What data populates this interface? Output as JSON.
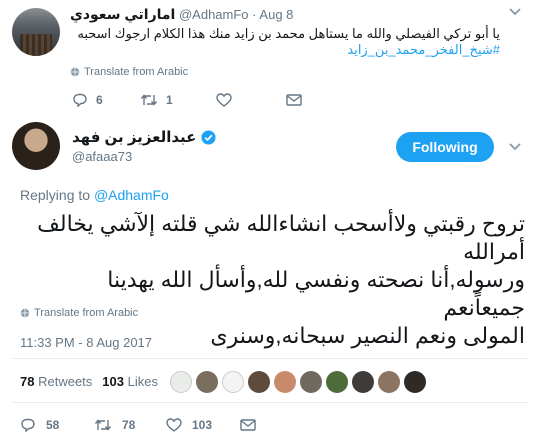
{
  "tweet1": {
    "display_name": "اماراتي سعودي",
    "handle": "@AdhamFo",
    "separator": "·",
    "date": "Aug 8",
    "text": "يا أبو تركي الفيصلي والله ما يستاهل محمد بن زايد منك هذا الكلام ارجوك اسحبه",
    "hashtag": "#شيخ_الفخر_محمد_بن_زايد",
    "translate": "Translate from Arabic",
    "actions": {
      "replies": "6",
      "retweets": "1"
    }
  },
  "tweet2": {
    "display_name": "عبدالعزيز بن فهد",
    "handle": "@afaaa73",
    "follow_label": "Following",
    "replying_prefix": "Replying to",
    "replying_to": "@AdhamFo",
    "text_line1": "تروح رقبتي ولاأسحب انشاءالله شي قلته إلآشي يخالف أمرالله",
    "text_line2": "ورسوله,أنا نصحته ونفسي لله,وأسأل الله يهدينا جميعاًنعم",
    "text_line3": "المولى ونعم النصير سبحانه,وسنرى",
    "translate": "Translate from Arabic",
    "timestamp": "11:33 PM - 8 Aug 2017",
    "stats": {
      "retweets_count": "78",
      "retweets_label": "Retweets",
      "likes_count": "103",
      "likes_label": "Likes"
    },
    "actions": {
      "replies": "58",
      "retweets": "78",
      "likes": "103"
    }
  },
  "colors": {
    "accent": "#1da1f2",
    "text": "#14171a",
    "muted": "#657786",
    "divider": "#e6ecf0"
  },
  "icons": [
    "chevron-down-icon",
    "globe-icon",
    "reply-icon",
    "retweet-icon",
    "heart-icon",
    "message-icon",
    "verified-icon"
  ]
}
